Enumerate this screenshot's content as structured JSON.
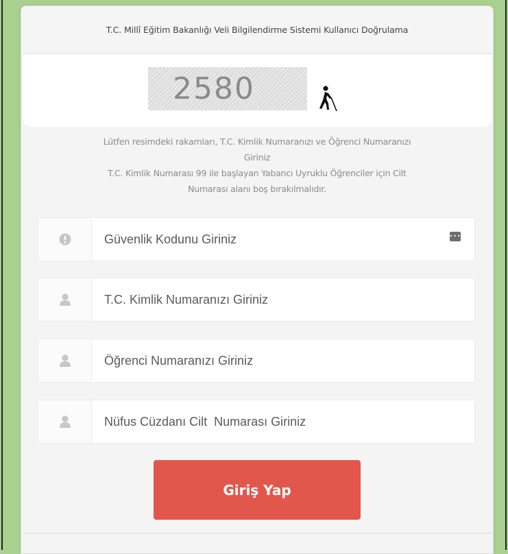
{
  "header": {
    "title": "T.C. Millî Eğitim Bakanlığı  Veli Bilgilendirme Sistemi Kullanıcı Doğrulama"
  },
  "captcha": {
    "code": "2580",
    "audio_icon": "accessibility-person-icon"
  },
  "instructions": {
    "line1": "Lütfen resimdeki rakamları, T.C. Kimlik Numaranızı ve Öğrenci Numaranızı",
    "line2": "Giriniz",
    "line3": "T.C. Kimlik Numarası 99 ile başlayan Yabancı Uyruklu Öğrenciler için Cilt",
    "line4": "Numarası alanı boş bırakılmalıdır."
  },
  "form": {
    "security_code": {
      "placeholder": "Güvenlik Kodunu Giriniz",
      "value": "",
      "icon": "exclamation-circle-icon"
    },
    "tc_kimlik": {
      "placeholder": "T.C. Kimlik Numaranızı Giriniz",
      "value": "",
      "icon": "user-icon"
    },
    "student_no": {
      "placeholder": "Öğrenci Numaranızı Giriniz",
      "value": "",
      "icon": "user-icon"
    },
    "cilt_no": {
      "placeholder": "Nüfus Cüzdanı Cilt  Numarası Giriniz",
      "value": "",
      "icon": "user-icon"
    }
  },
  "submit_label": "Giriş Yap",
  "colors": {
    "background": "#a9d08e",
    "button": "#e2574c",
    "icon_gray": "#c7c7c7"
  }
}
